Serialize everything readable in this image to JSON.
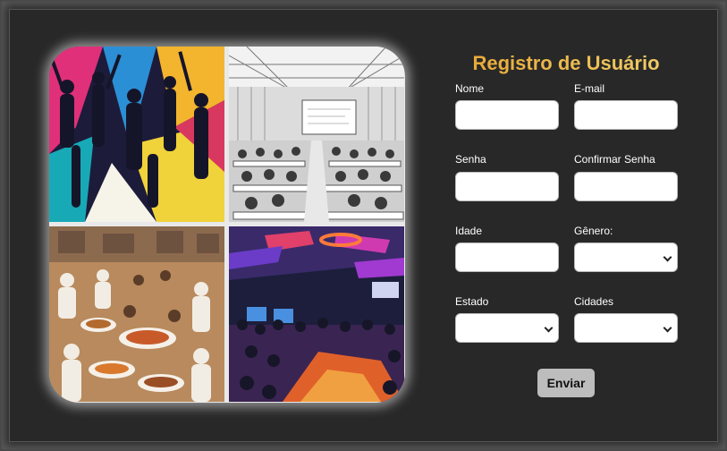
{
  "form": {
    "title": "Registro de Usuário",
    "fields": {
      "nome": {
        "label": "Nome",
        "value": ""
      },
      "email": {
        "label": "E-mail",
        "value": ""
      },
      "senha": {
        "label": "Senha",
        "value": ""
      },
      "confirmar_senha": {
        "label": "Confirmar Senha",
        "value": ""
      },
      "idade": {
        "label": "Idade",
        "value": ""
      },
      "genero": {
        "label": "Gênero:",
        "value": ""
      },
      "estado": {
        "label": "Estado",
        "value": ""
      },
      "cidades": {
        "label": "Cidades",
        "value": ""
      }
    },
    "submit_label": "Enviar"
  },
  "collage": {
    "images": [
      "party-dance-image",
      "conference-hall-image",
      "food-festival-image",
      "gaming-event-image"
    ]
  },
  "colors": {
    "background": "#282828",
    "title_gradient_start": "#e8a634",
    "title_gradient_end": "#f0cf6a",
    "button": "#bdbdbd"
  }
}
